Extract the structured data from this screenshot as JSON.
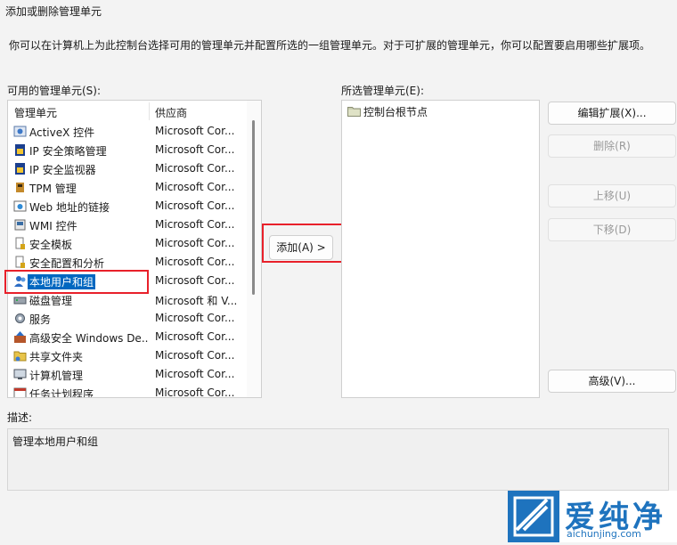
{
  "window": {
    "title": "添加或删除管理单元"
  },
  "intro": "你可以在计算机上为此控制台选择可用的管理单元并配置所选的一组管理单元。对于可扩展的管理单元，你可以配置要启用哪些扩展项。",
  "available": {
    "label": "可用的管理单元(S):",
    "col_name": "管理单元",
    "col_vendor": "供应商",
    "items": [
      {
        "name": "ActiveX 控件",
        "vendor": "Microsoft Cor...",
        "icon": "activex-icon"
      },
      {
        "name": "IP 安全策略管理",
        "vendor": "Microsoft Cor...",
        "icon": "ip-security-policy-icon"
      },
      {
        "name": "IP 安全监视器",
        "vendor": "Microsoft Cor...",
        "icon": "ip-security-monitor-icon"
      },
      {
        "name": "TPM 管理",
        "vendor": "Microsoft Cor...",
        "icon": "tpm-icon"
      },
      {
        "name": "Web 地址的链接",
        "vendor": "Microsoft Cor...",
        "icon": "web-link-icon"
      },
      {
        "name": "WMI 控件",
        "vendor": "Microsoft Cor...",
        "icon": "wmi-icon"
      },
      {
        "name": "安全模板",
        "vendor": "Microsoft Cor...",
        "icon": "security-template-icon"
      },
      {
        "name": "安全配置和分析",
        "vendor": "Microsoft Cor...",
        "icon": "security-config-icon"
      },
      {
        "name": "本地用户和组",
        "vendor": "Microsoft Cor...",
        "icon": "users-groups-icon",
        "selected": true
      },
      {
        "name": "磁盘管理",
        "vendor": "Microsoft 和 V...",
        "icon": "disk-icon"
      },
      {
        "name": "服务",
        "vendor": "Microsoft Cor...",
        "icon": "services-gear-icon"
      },
      {
        "name": "高级安全 Windows De...",
        "vendor": "Microsoft Cor...",
        "icon": "firewall-icon"
      },
      {
        "name": "共享文件夹",
        "vendor": "Microsoft Cor...",
        "icon": "shared-folder-icon"
      },
      {
        "name": "计算机管理",
        "vendor": "Microsoft Cor...",
        "icon": "computer-management-icon"
      },
      {
        "name": "任务计划程序",
        "vendor": "Microsoft Cor...",
        "icon": "task-scheduler-icon"
      }
    ]
  },
  "add_button": "添加(A) >",
  "selected": {
    "label": "所选管理单元(E):",
    "items": [
      {
        "name": "控制台根节点",
        "icon": "folder-icon"
      }
    ]
  },
  "buttons": {
    "edit_ext": "编辑扩展(X)...",
    "remove": "删除(R)",
    "move_up": "上移(U)",
    "move_down": "下移(D)",
    "advanced": "高级(V)..."
  },
  "description": {
    "label": "描述:",
    "text": "管理本地用户和组"
  },
  "watermark": {
    "cn": "爱纯净",
    "en": "aichunjing.com"
  }
}
